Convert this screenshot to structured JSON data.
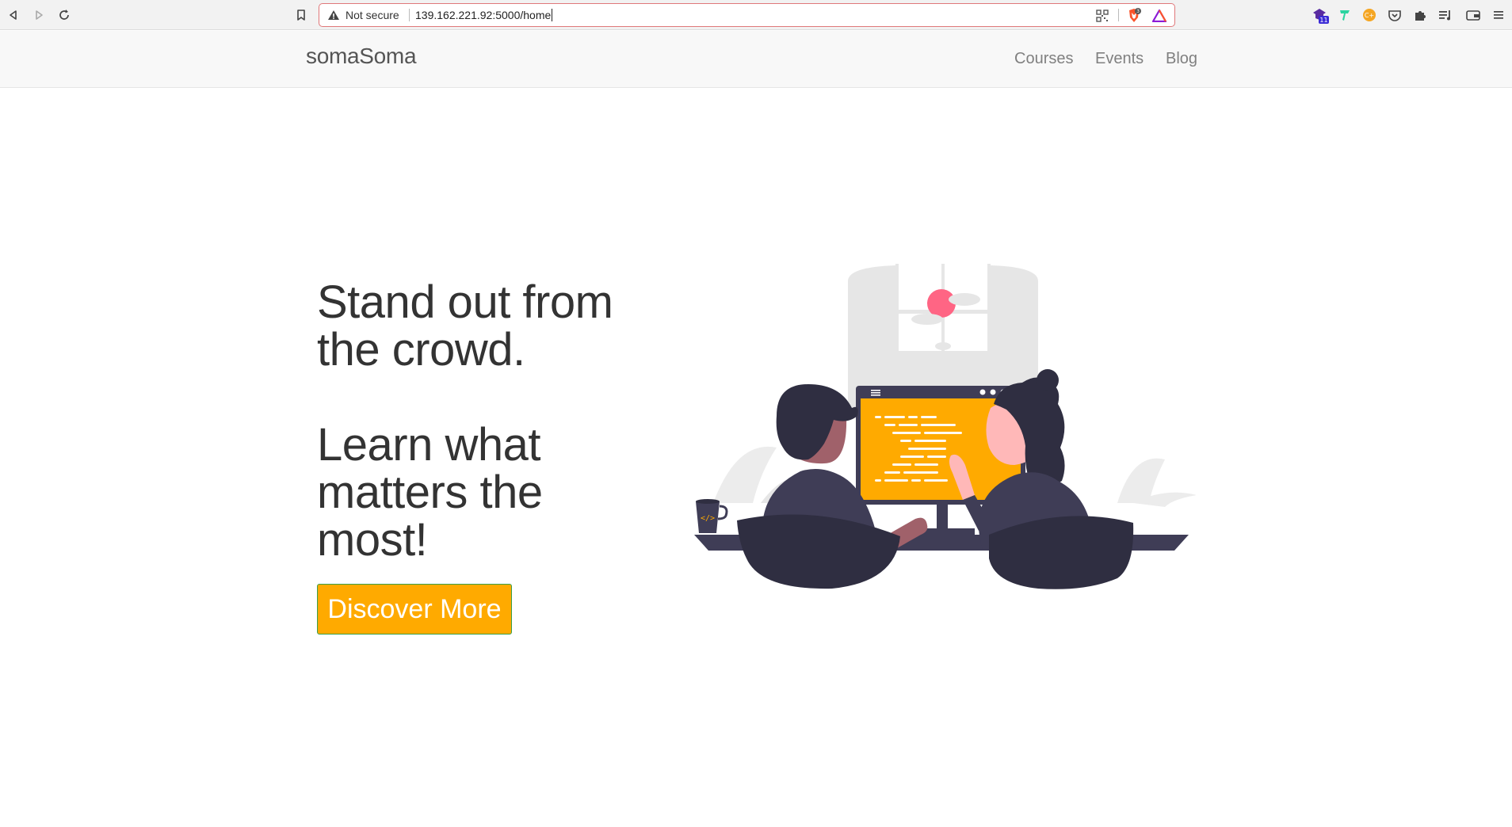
{
  "browser": {
    "security_label": "Not secure",
    "url": "139.162.221.92:5000/home",
    "brave_badge": "3",
    "ext_badge": "11"
  },
  "site": {
    "brand": "somaSoma",
    "nav": [
      "Courses",
      "Events",
      "Blog"
    ]
  },
  "hero": {
    "headline_lines": [
      "Stand out from",
      "the crowd."
    ],
    "subheadline_lines": [
      "Learn what",
      "matters the",
      "most!"
    ],
    "cta_label": "Discover More"
  },
  "colors": {
    "accent": "#ffaa00",
    "accent_border": "#3aa04a",
    "illustration_dark": "#3f3d56",
    "illustration_pink": "#ff6584"
  },
  "icons": [
    "back-icon",
    "forward-icon",
    "reload-icon",
    "bookmark-icon",
    "warning-icon",
    "qr-code-icon",
    "brave-shield-icon",
    "brave-rewards-icon",
    "extension-icon",
    "puzzle-icon",
    "reading-list-icon",
    "wallet-icon",
    "menu-icon"
  ]
}
